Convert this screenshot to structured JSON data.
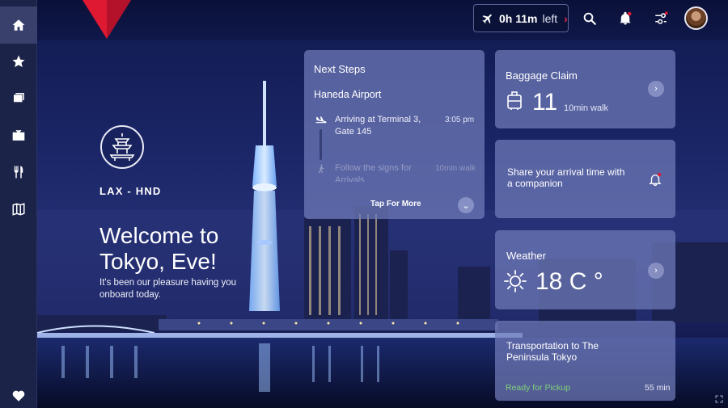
{
  "topbar": {
    "flight_time": "0h 11m",
    "flight_suffix": "left",
    "icons": [
      "plane-icon",
      "search-icon",
      "bell-icon",
      "settings-icon",
      "avatar"
    ]
  },
  "sidebar": {
    "items": [
      {
        "name": "home",
        "icon": "home-icon",
        "active": true
      },
      {
        "name": "favorites",
        "icon": "star-icon"
      },
      {
        "name": "movies",
        "icon": "film-icon"
      },
      {
        "name": "tv",
        "icon": "tv-icon"
      },
      {
        "name": "dining",
        "icon": "utensils-icon"
      },
      {
        "name": "map",
        "icon": "map-icon"
      },
      {
        "name": "wellness",
        "icon": "heart-icon"
      }
    ]
  },
  "welcome": {
    "route": "LAX - HND",
    "heading": "Welcome to Tokyo, Eve!",
    "message": "It's been our pleasure having you onboard today."
  },
  "next_steps": {
    "title": "Next Steps",
    "location": "Haneda Airport",
    "steps": [
      {
        "text": "Arriving at Terminal 3, Gate 145",
        "time": "3:05 pm",
        "icon": "plane-landing-icon"
      },
      {
        "text": "Follow the signs for Arrivals",
        "time": "10min walk",
        "icon": "walking-icon"
      }
    ],
    "tap_more": "Tap For More"
  },
  "baggage": {
    "title": "Baggage Claim",
    "number": "11",
    "walk": "10min walk"
  },
  "share": {
    "title": "Share your arrival time with a companion"
  },
  "weather": {
    "title": "Weather",
    "temp": "18 C °"
  },
  "transport": {
    "title": "Transportation to The Peninsula Tokyo",
    "status": "Ready for Pickup",
    "eta": "55 min"
  },
  "colors": {
    "brand_red": "#e01933",
    "status_green": "#7fd37a",
    "card": "#707cba"
  }
}
